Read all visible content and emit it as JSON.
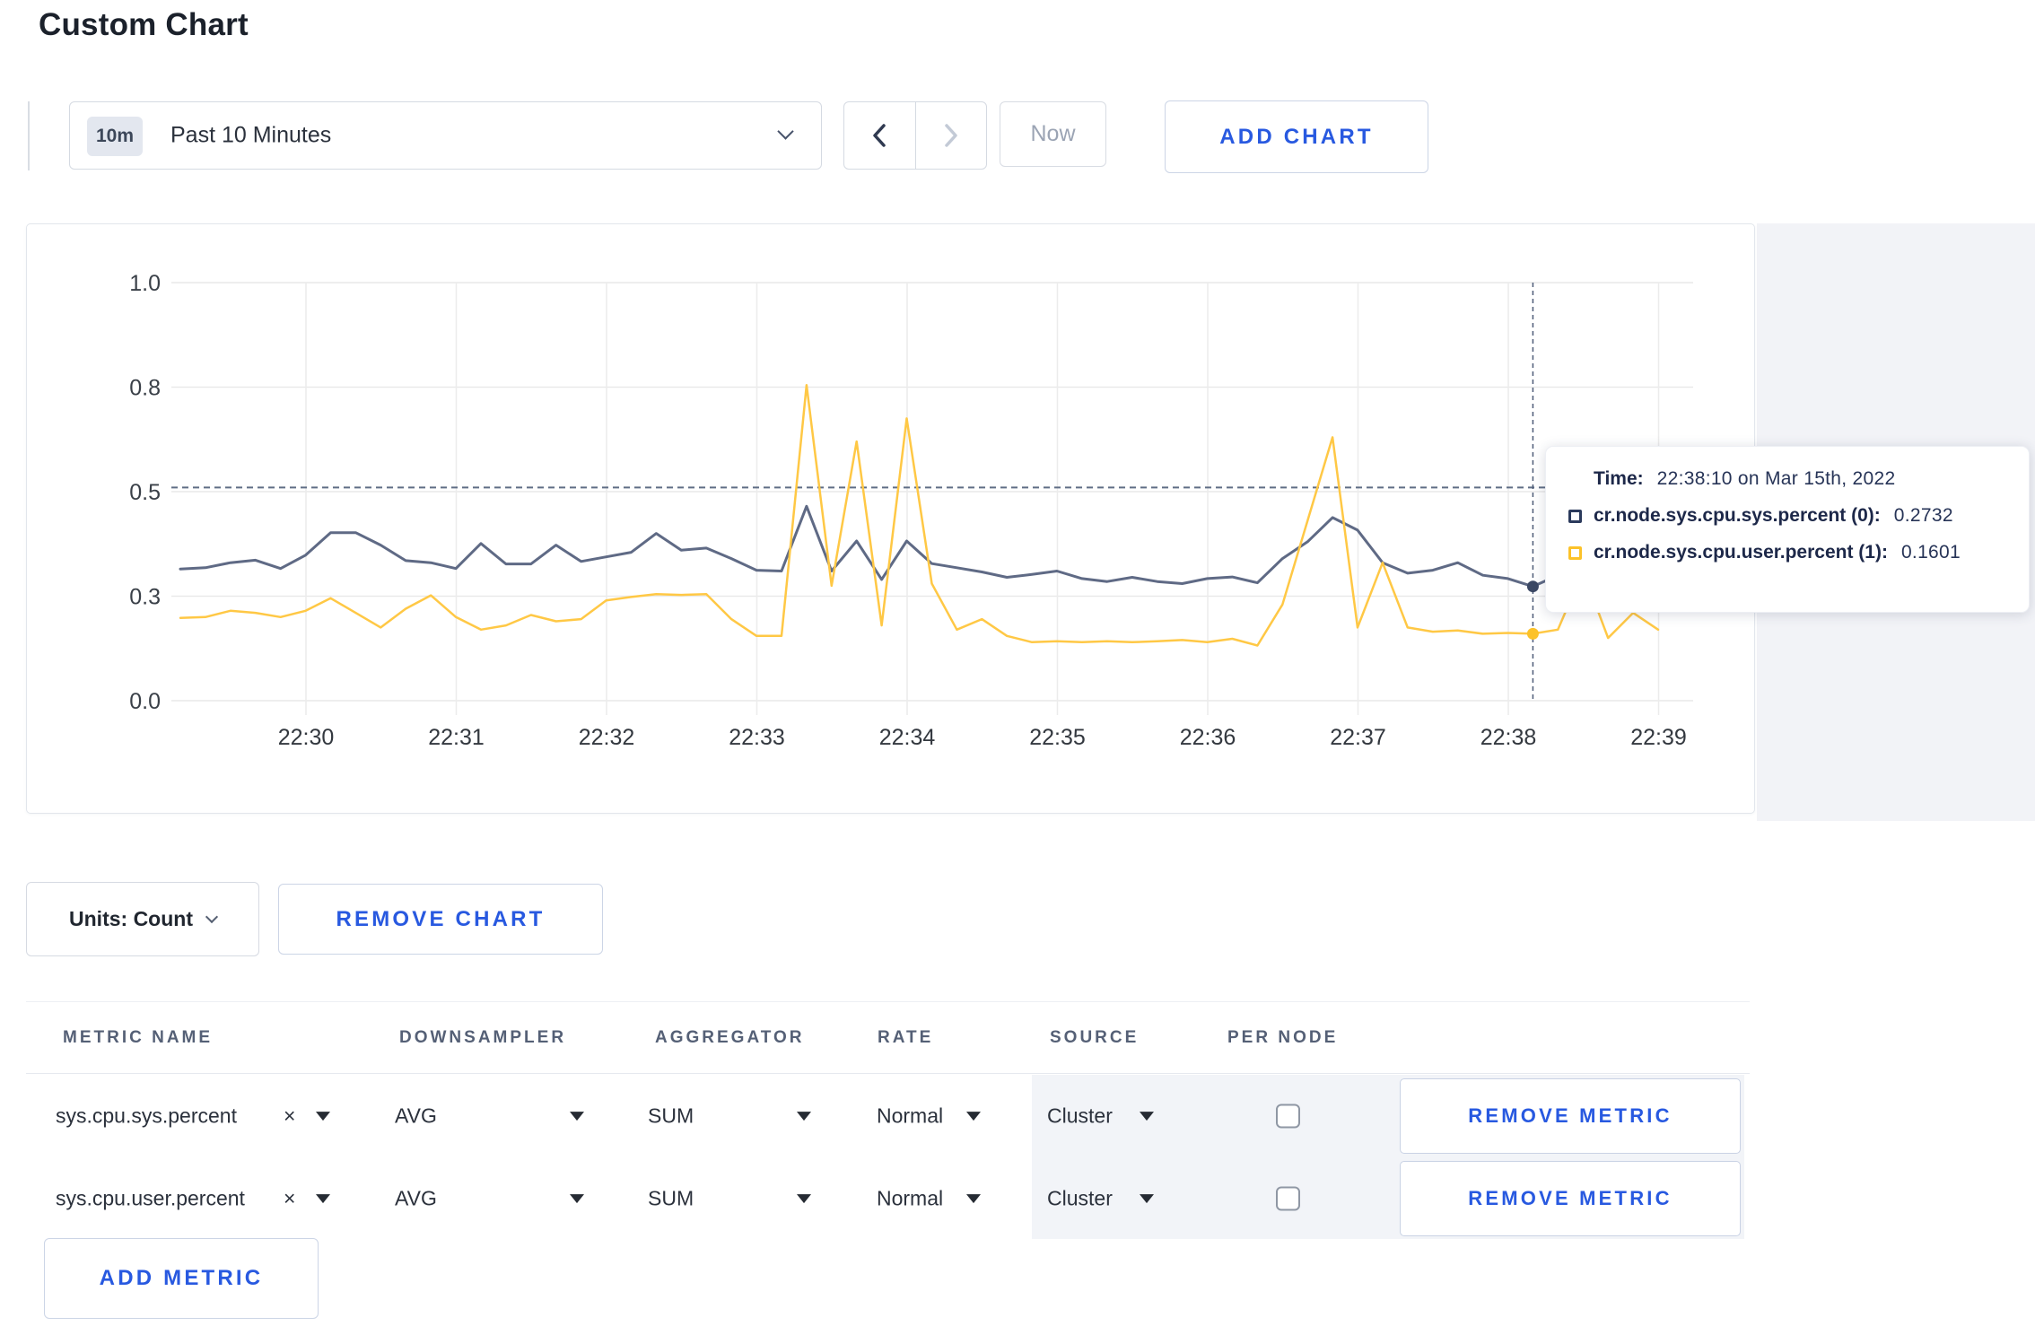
{
  "page": {
    "title": "Custom Chart"
  },
  "toolbar": {
    "time_range": {
      "badge": "10m",
      "label": "Past 10 Minutes"
    },
    "now_label": "Now",
    "add_chart_label": "ADD CHART"
  },
  "chart": {
    "tooltip": {
      "time_label": "Time:",
      "time_value": "22:38:10 on Mar 15th, 2022",
      "series": [
        {
          "label": "cr.node.sys.cpu.sys.percent (0):",
          "value": "0.2732",
          "swatch_color": "#2b3a5c"
        },
        {
          "label": "cr.node.sys.cpu.user.percent (1):",
          "value": "0.1601",
          "swatch_color": "#fcc229"
        }
      ]
    }
  },
  "chart_data": {
    "type": "line",
    "title": "",
    "xlabel": "",
    "ylabel": "",
    "ylim": [
      0,
      1
    ],
    "grid": true,
    "x_ticks": [
      "22:30",
      "22:31",
      "22:32",
      "22:33",
      "22:34",
      "22:35",
      "22:36",
      "22:37",
      "22:38",
      "22:39"
    ],
    "y_ticks": {
      "values": [
        0,
        0.25,
        0.5,
        0.75,
        1.0
      ],
      "labels": [
        "0.0",
        "0.3",
        "0.5",
        "0.8",
        "1.0"
      ]
    },
    "start_time": "22:29:10",
    "interval_seconds": 10,
    "threshold_line_value": 0.51,
    "crosshair": {
      "time": "22:38:10",
      "index": 54
    },
    "series": [
      {
        "name": "cr.node.sys.cpu.sys.percent",
        "color": "#5f6a85",
        "marker_color": "#3b4864",
        "values": [
          0.315,
          0.318,
          0.33,
          0.336,
          0.316,
          0.348,
          0.402,
          0.402,
          0.372,
          0.335,
          0.33,
          0.316,
          0.376,
          0.327,
          0.327,
          0.372,
          0.333,
          0.344,
          0.355,
          0.4,
          0.36,
          0.365,
          0.34,
          0.312,
          0.31,
          0.465,
          0.31,
          0.382,
          0.29,
          0.382,
          0.328,
          0.318,
          0.308,
          0.295,
          0.302,
          0.31,
          0.292,
          0.285,
          0.295,
          0.285,
          0.28,
          0.292,
          0.296,
          0.282,
          0.34,
          0.38,
          0.438,
          0.408,
          0.33,
          0.305,
          0.312,
          0.33,
          0.3,
          0.292,
          0.2732,
          0.3,
          0.308,
          0.295,
          0.305,
          0.298
        ]
      },
      {
        "name": "cr.node.sys.cpu.user.percent",
        "color": "#ffc845",
        "marker_color": "#fcc229",
        "values": [
          0.198,
          0.2,
          0.215,
          0.21,
          0.2,
          0.215,
          0.245,
          0.21,
          0.175,
          0.22,
          0.252,
          0.2,
          0.17,
          0.18,
          0.205,
          0.19,
          0.195,
          0.24,
          0.248,
          0.255,
          0.253,
          0.255,
          0.195,
          0.155,
          0.155,
          0.755,
          0.275,
          0.62,
          0.18,
          0.675,
          0.28,
          0.17,
          0.195,
          0.155,
          0.14,
          0.142,
          0.14,
          0.142,
          0.14,
          0.142,
          0.145,
          0.14,
          0.148,
          0.132,
          0.23,
          0.43,
          0.63,
          0.175,
          0.33,
          0.175,
          0.165,
          0.168,
          0.16,
          0.162,
          0.1601,
          0.17,
          0.31,
          0.15,
          0.21,
          0.17
        ]
      }
    ]
  },
  "chart_controls": {
    "units_label": "Units: Count",
    "remove_chart_label": "REMOVE CHART"
  },
  "metrics_table": {
    "headers": [
      "METRIC NAME",
      "DOWNSAMPLER",
      "AGGREGATOR",
      "RATE",
      "SOURCE",
      "PER NODE"
    ],
    "rows": [
      {
        "metric": "sys.cpu.sys.percent",
        "downsampler": "AVG",
        "aggregator": "SUM",
        "rate": "Normal",
        "source": "Cluster",
        "per_node_checked": false,
        "remove_label": "REMOVE METRIC"
      },
      {
        "metric": "sys.cpu.user.percent",
        "downsampler": "AVG",
        "aggregator": "SUM",
        "rate": "Normal",
        "source": "Cluster",
        "per_node_checked": false,
        "remove_label": "REMOVE METRIC"
      }
    ],
    "add_metric_label": "ADD METRIC"
  }
}
